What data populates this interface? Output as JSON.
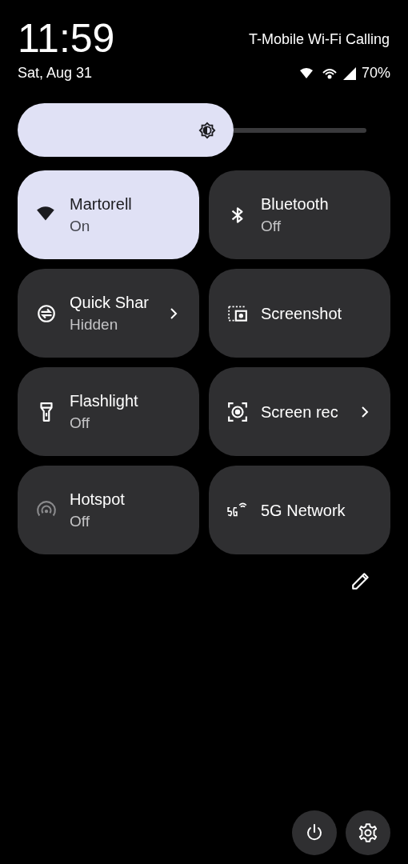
{
  "status": {
    "time": "11:59",
    "date": "Sat, Aug 31",
    "carrier": "T-Mobile Wi-Fi Calling",
    "battery": "70%"
  },
  "brightness": {
    "level": 0.62
  },
  "tiles": [
    {
      "kind": "wifi",
      "title": "Martorell",
      "subtitle": "On",
      "selected": true,
      "disabled": false,
      "chevron": false
    },
    {
      "kind": "bluetooth",
      "title": "Bluetooth",
      "subtitle": "Off",
      "selected": false,
      "disabled": false,
      "chevron": false
    },
    {
      "kind": "share",
      "title": "Quick Shar",
      "subtitle": "Hidden",
      "selected": false,
      "disabled": false,
      "chevron": true
    },
    {
      "kind": "screenshot",
      "title": "Screenshot",
      "selected": false,
      "disabled": false,
      "chevron": false
    },
    {
      "kind": "flashlight",
      "title": "Flashlight",
      "subtitle": "Off",
      "selected": false,
      "disabled": false,
      "chevron": false
    },
    {
      "kind": "record",
      "title": "Screen rec",
      "selected": false,
      "disabled": false,
      "chevron": true
    },
    {
      "kind": "hotspot",
      "title": "Hotspot",
      "subtitle": "Off",
      "selected": false,
      "disabled": true,
      "chevron": false
    },
    {
      "kind": "network",
      "title": "5G Network",
      "selected": false,
      "disabled": false,
      "chevron": false
    }
  ]
}
